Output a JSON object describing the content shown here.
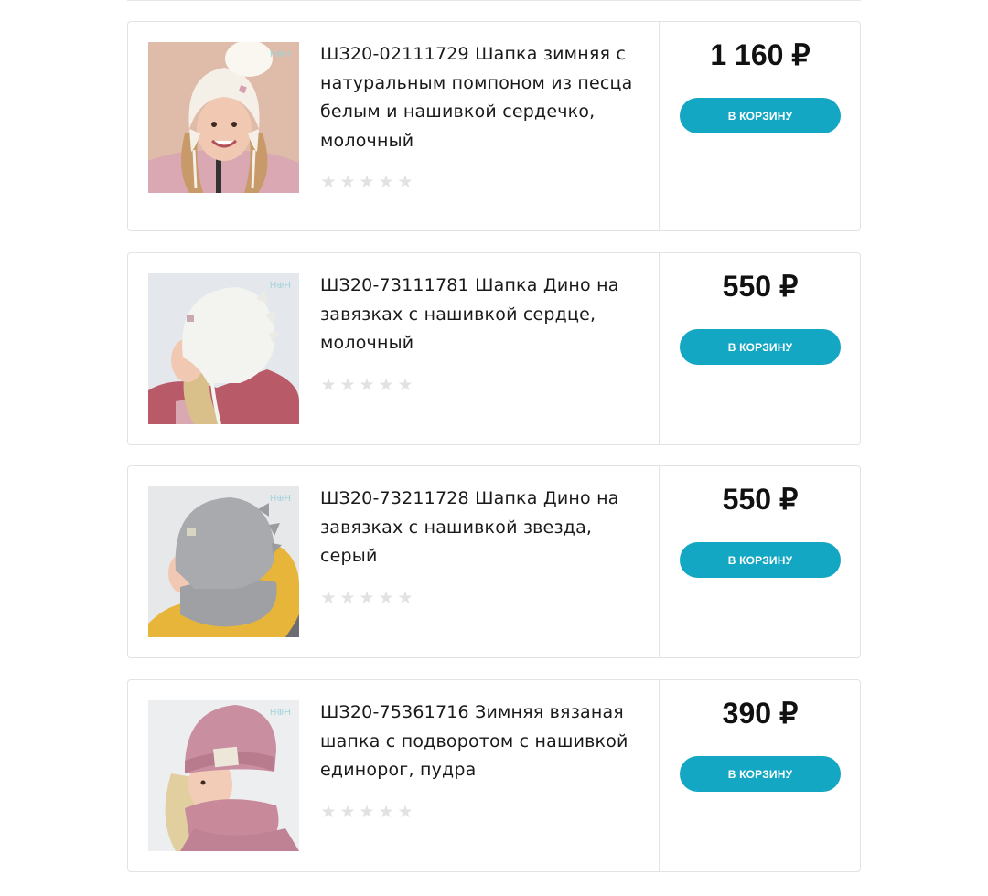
{
  "products": [
    {
      "title": "ШЗ20-02111729 Шапка зимняя с натуральным помпоном из песца белым и нашивкой сердечко, молочный",
      "price": "1 160 ₽",
      "button_label": "В КОРЗИНУ",
      "rating": 0,
      "image": "girl-white-pompom-hat-photo"
    },
    {
      "title": "ШЗ20-73111781 Шапка Дино на завязках с нашивкой сердце, молочный",
      "price": "550 ₽",
      "button_label": "В КОРЗИНУ",
      "rating": 0,
      "image": "girl-white-dino-hat-photo"
    },
    {
      "title": "ШЗ20-73211728 Шапка Дино на завязках с нашивкой звезда, серый",
      "price": "550 ₽",
      "button_label": "В КОРЗИНУ",
      "rating": 0,
      "image": "child-grey-dino-hat-photo"
    },
    {
      "title": "ШЗ20-75361716 Зимняя вязаная шапка с подворотом с нашивкой единорог, пудра",
      "price": "390 ₽",
      "button_label": "В КОРЗИНУ",
      "rating": 0,
      "image": "girl-pink-knit-hat-photo"
    }
  ],
  "colors": {
    "button": "#14a7c4",
    "star_empty": "#e2e2e2",
    "border": "#e3e3e3"
  }
}
